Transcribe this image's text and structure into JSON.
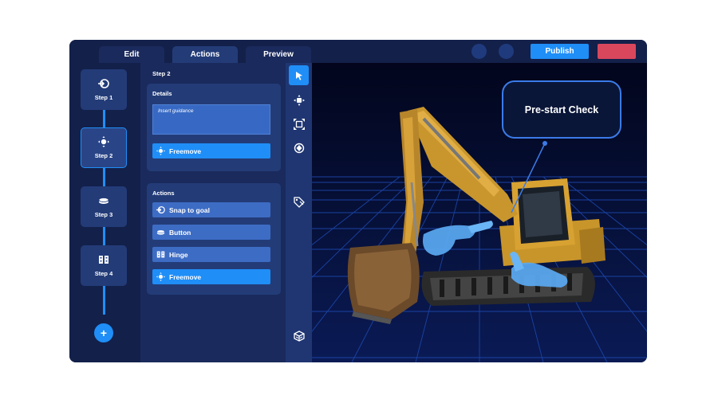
{
  "header": {
    "tabs": [
      {
        "label": "Edit",
        "active": false
      },
      {
        "label": "Actions",
        "active": true
      },
      {
        "label": "Preview",
        "active": false
      }
    ],
    "publish_label": "Publish",
    "accent_color": "#1f8ef7",
    "danger_color": "#d9475c"
  },
  "steps": {
    "items": [
      {
        "label": "Step 1",
        "icon": "snap-icon"
      },
      {
        "label": "Step 2",
        "icon": "freemove-icon",
        "active": true
      },
      {
        "label": "Step 3",
        "icon": "button-icon"
      },
      {
        "label": "Step 4",
        "icon": "hinge-icon"
      }
    ],
    "add_label": "+"
  },
  "properties": {
    "title": "Step 2",
    "details": {
      "title": "Details",
      "guidance_placeholder": "Insert guidance",
      "selected_action": "Freemove"
    },
    "actions": {
      "title": "Actions",
      "items": [
        {
          "label": "Snap to goal",
          "icon": "snap-icon"
        },
        {
          "label": "Button",
          "icon": "button-icon"
        },
        {
          "label": "Hinge",
          "icon": "hinge-icon"
        },
        {
          "label": "Freemove",
          "icon": "freemove-icon",
          "highlighted": true
        }
      ]
    }
  },
  "tools": [
    "cursor-icon",
    "move-icon",
    "scale-icon",
    "rotate-icon",
    "tag-icon",
    "cube-icon"
  ],
  "viewport": {
    "callout_text": "Pre-start Check",
    "scene": "excavator-with-hands"
  }
}
